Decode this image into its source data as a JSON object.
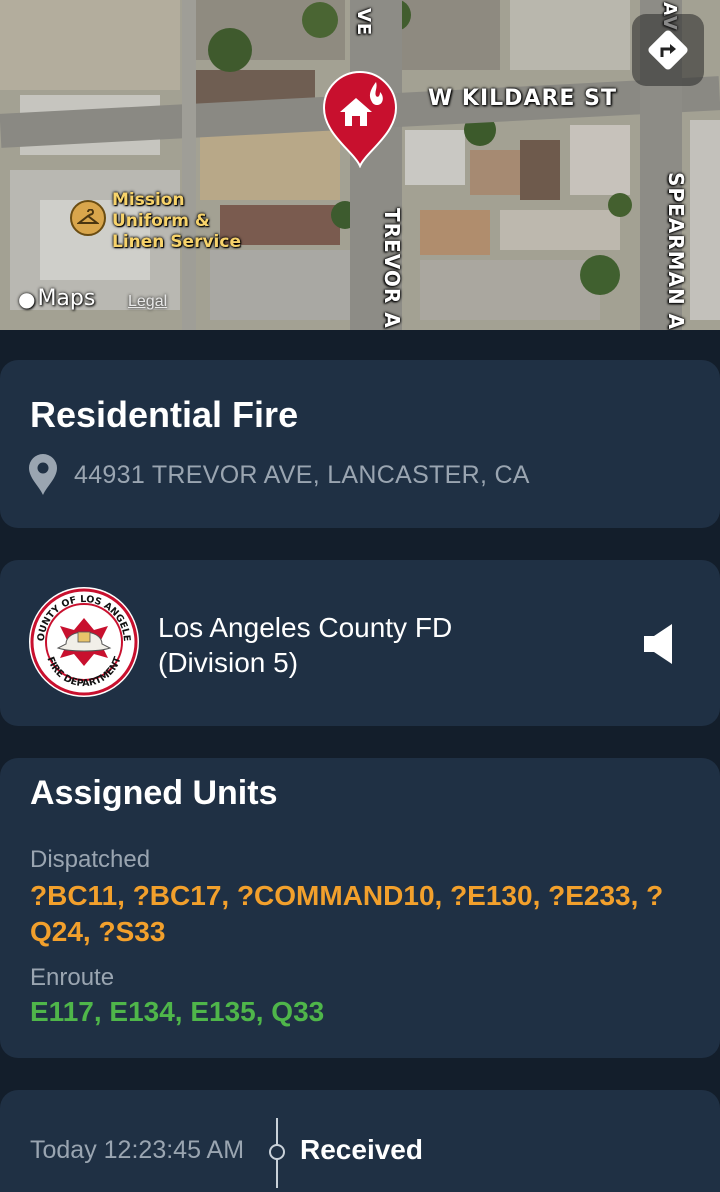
{
  "map": {
    "streets": {
      "kildare": "W KILDARE ST",
      "ave_top": "VE",
      "trevor": "TREVOR A",
      "spearman": "SPEARMAN A",
      "av_top": "AV"
    },
    "poi": {
      "line1": "Mission",
      "line2": "Uniform &",
      "line3": "Linen Service",
      "icon": "hanger-icon"
    },
    "pin_icon": "house-fire-icon",
    "route_button_icon": "directions-icon",
    "brand": "Maps",
    "legal": "Legal"
  },
  "incident": {
    "title": "Residential Fire",
    "address": "44931 TREVOR AVE, LANCASTER, CA",
    "location_icon": "location-pin-icon"
  },
  "agency": {
    "name_line1": "Los Angeles County FD",
    "name_line2": "(Division 5)",
    "seal_text_top": "COUNTY OF LOS ANGELES",
    "seal_text_bottom": "FIRE DEPARTMENT",
    "speaker_icon": "speaker-icon"
  },
  "units": {
    "title": "Assigned Units",
    "dispatched_label": "Dispatched",
    "dispatched": "?BC11, ?BC17, ?COMMAND10, ?E130, ?E233, ?Q24, ?S33",
    "enroute_label": "Enroute",
    "enroute": "E117, E134, E135, Q33"
  },
  "timeline": [
    {
      "time": "Today 12:23:45 AM",
      "status": "Received"
    }
  ],
  "colors": {
    "background": "#131e2b",
    "card": "#1f3044",
    "dispatched": "#f2a02c",
    "enroute": "#4fb64a",
    "pin": "#c8102e"
  }
}
